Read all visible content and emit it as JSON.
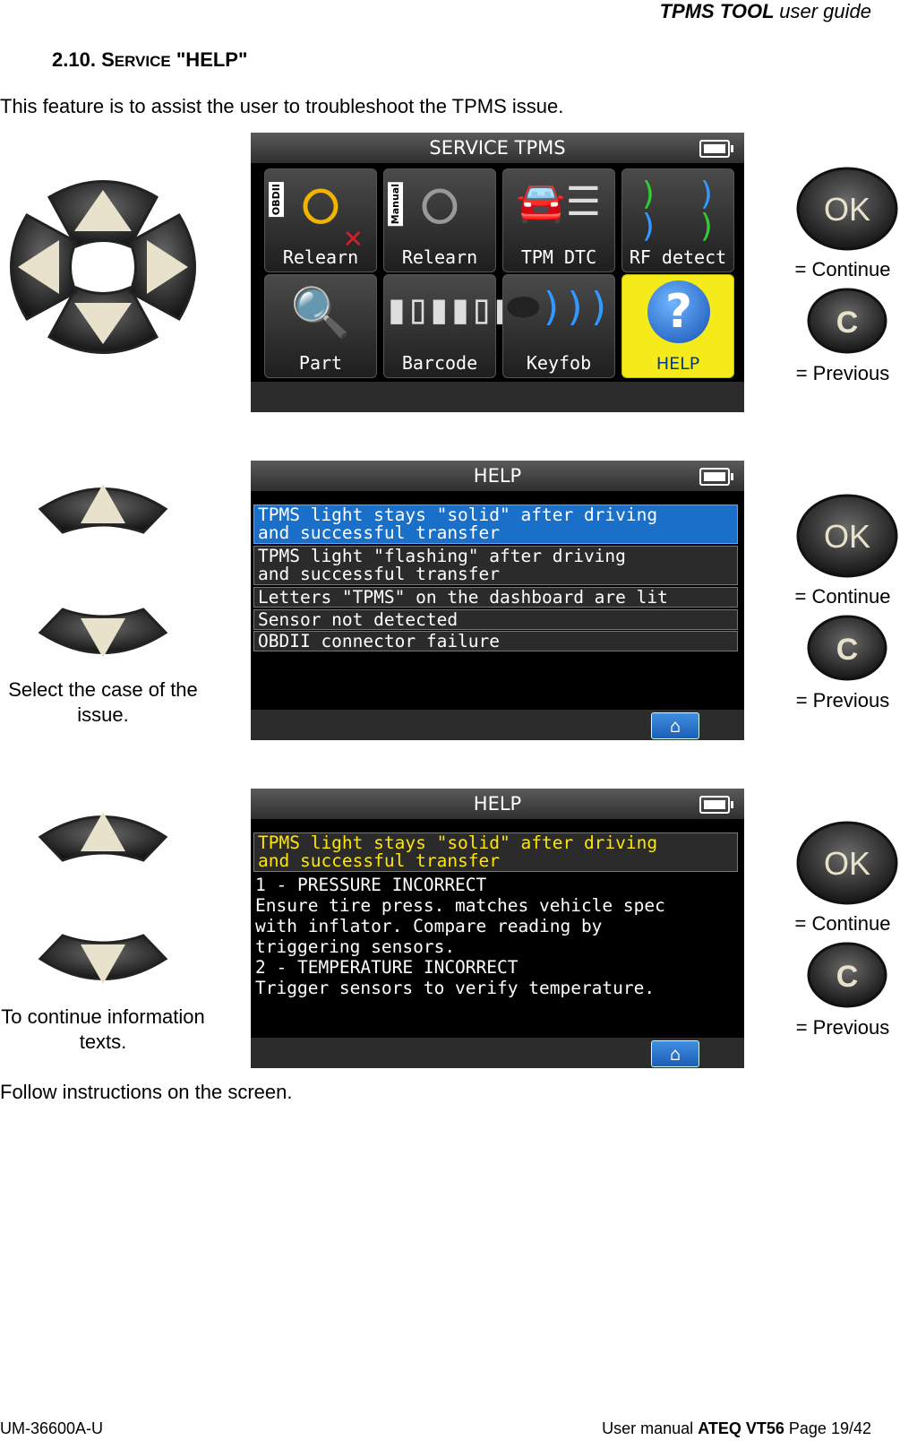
{
  "header": {
    "product": "TPMS TOOL",
    "doc_type": "user guide"
  },
  "section": {
    "number": "2.10.",
    "title_first": "S",
    "title_rest": "ERVICE",
    "title_quoted": "\"HELP\""
  },
  "intro": "This feature is to assist the user to troubleshoot the TPMS issue.",
  "screen1": {
    "title": "SERVICE TPMS",
    "tiles": [
      {
        "label": "Relearn",
        "icon": "obdii-relearn-icon"
      },
      {
        "label": "Relearn",
        "icon": "manual-relearn-icon"
      },
      {
        "label": "TPM DTC",
        "icon": "dtc-icon"
      },
      {
        "label": "RF detect",
        "icon": "rf-detect-icon"
      },
      {
        "label": "Part",
        "icon": "part-magnifier-icon"
      },
      {
        "label": "Barcode",
        "icon": "barcode-icon"
      },
      {
        "label": "Keyfob",
        "icon": "keyfob-icon"
      },
      {
        "label": "HELP",
        "icon": "help-question-icon"
      }
    ],
    "badge_obdii": "OBDII",
    "badge_manual": "Manual"
  },
  "screen2": {
    "title": "HELP",
    "items": [
      "TPMS light stays \"solid\" after driving\nand successful transfer",
      "TPMS light \"flashing\" after driving\nand successful transfer",
      "Letters \"TPMS\" on the dashboard are lit",
      "Sensor not detected",
      "OBDII connector failure"
    ]
  },
  "screen3": {
    "title": "HELP",
    "selected": "TPMS light stays \"solid\" after driving\nand successful transfer",
    "info": "1 - PRESSURE INCORRECT\nEnsure tire press. matches vehicle spec\nwith inflator. Compare reading by\ntriggering sensors.\n2 - TEMPERATURE INCORRECT\nTrigger sensors to verify temperature."
  },
  "keys": {
    "ok": "OK",
    "c": "C",
    "continue": "= Continue",
    "previous": "= Previous"
  },
  "captions": {
    "select_case": "Select the case of the issue.",
    "continue_info": "To continue information texts."
  },
  "outro": "Follow instructions on the screen.",
  "footer": {
    "code": "UM-36600A-U",
    "manual_prefix": "User manual",
    "manual_name": "ATEQ VT56",
    "page": "Page 19/42"
  }
}
